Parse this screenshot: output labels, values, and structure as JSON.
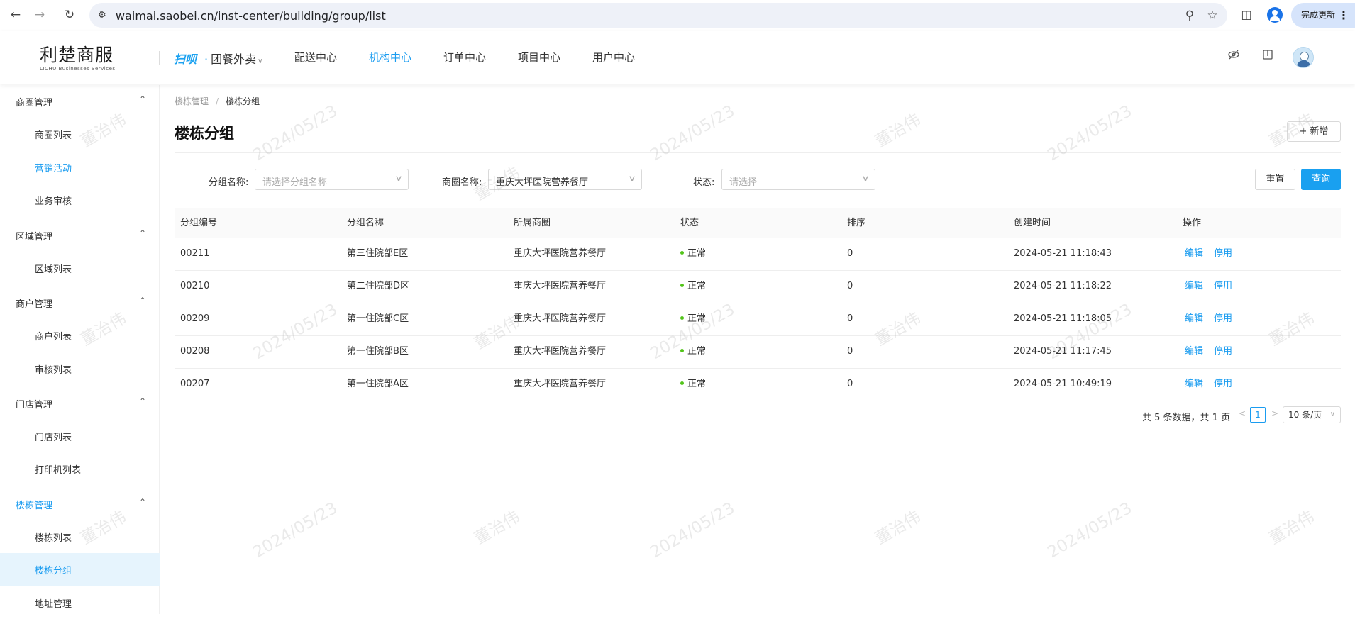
{
  "browser": {
    "url": "waimai.saobei.cn/inst-center/building/group/list",
    "update_label": "完成更新"
  },
  "header": {
    "logo_cn": "利楚商服",
    "logo_en": "LICHU Businesses Services",
    "brand_mark": "扫呗",
    "brand_select": "团餐外卖",
    "nav": [
      {
        "label": "配送中心",
        "active": false
      },
      {
        "label": "机构中心",
        "active": true
      },
      {
        "label": "订单中心",
        "active": false
      },
      {
        "label": "项目中心",
        "active": false
      },
      {
        "label": "用户中心",
        "active": false
      }
    ]
  },
  "sidebar": {
    "groups": [
      {
        "label": "商圈管理",
        "items": [
          "商圈列表",
          "营销活动",
          "业务审核"
        ]
      },
      {
        "label": "区域管理",
        "items": [
          "区域列表"
        ]
      },
      {
        "label": "商户管理",
        "items": [
          "商户列表",
          "审核列表"
        ]
      },
      {
        "label": "门店管理",
        "items": [
          "门店列表",
          "打印机列表"
        ]
      },
      {
        "label": "楼栋管理",
        "items": [
          "楼栋列表",
          "楼栋分组",
          "地址管理"
        ]
      }
    ],
    "active_group": "楼栋管理",
    "active_item": "楼栋分组",
    "highlighted_item": "营销活动"
  },
  "breadcrumb": {
    "parent": "楼栋管理",
    "current": "楼栋分组"
  },
  "page": {
    "title": "楼栋分组",
    "add_button": "新增"
  },
  "filters": {
    "group_name_label": "分组名称:",
    "group_name_placeholder": "请选择分组名称",
    "area_label": "商圈名称:",
    "area_value": "重庆大坪医院营养餐厅",
    "status_label": "状态:",
    "status_placeholder": "请选择",
    "reset_button": "重置",
    "query_button": "查询"
  },
  "table": {
    "columns": [
      "分组编号",
      "分组名称",
      "所属商圈",
      "状态",
      "排序",
      "创建时间",
      "操作"
    ],
    "rows": [
      {
        "id": "00211",
        "name": "第三住院部E区",
        "area": "重庆大坪医院营养餐厅",
        "status": "正常",
        "sort": "0",
        "created": "2024-05-21 11:18:43",
        "edit": "编辑",
        "disable": "停用"
      },
      {
        "id": "00210",
        "name": "第二住院部D区",
        "area": "重庆大坪医院营养餐厅",
        "status": "正常",
        "sort": "0",
        "created": "2024-05-21 11:18:22",
        "edit": "编辑",
        "disable": "停用"
      },
      {
        "id": "00209",
        "name": "第一住院部C区",
        "area": "重庆大坪医院营养餐厅",
        "status": "正常",
        "sort": "0",
        "created": "2024-05-21 11:18:05",
        "edit": "编辑",
        "disable": "停用"
      },
      {
        "id": "00208",
        "name": "第一住院部B区",
        "area": "重庆大坪医院营养餐厅",
        "status": "正常",
        "sort": "0",
        "created": "2024-05-21 11:17:45",
        "edit": "编辑",
        "disable": "停用"
      },
      {
        "id": "00207",
        "name": "第一住院部A区",
        "area": "重庆大坪医院营养餐厅",
        "status": "正常",
        "sort": "0",
        "created": "2024-05-21 10:49:19",
        "edit": "编辑",
        "disable": "停用"
      }
    ]
  },
  "pagination": {
    "total_text": "共 5 条数据，共 1 页",
    "current_page": "1",
    "page_size": "10 条/页"
  },
  "watermark": {
    "name": "董治伟",
    "date": "2024/05/23"
  },
  "colors": {
    "accent": "#1a9cf0",
    "status_ok": "#52c41a",
    "active_bg": "#e6f4fd"
  }
}
